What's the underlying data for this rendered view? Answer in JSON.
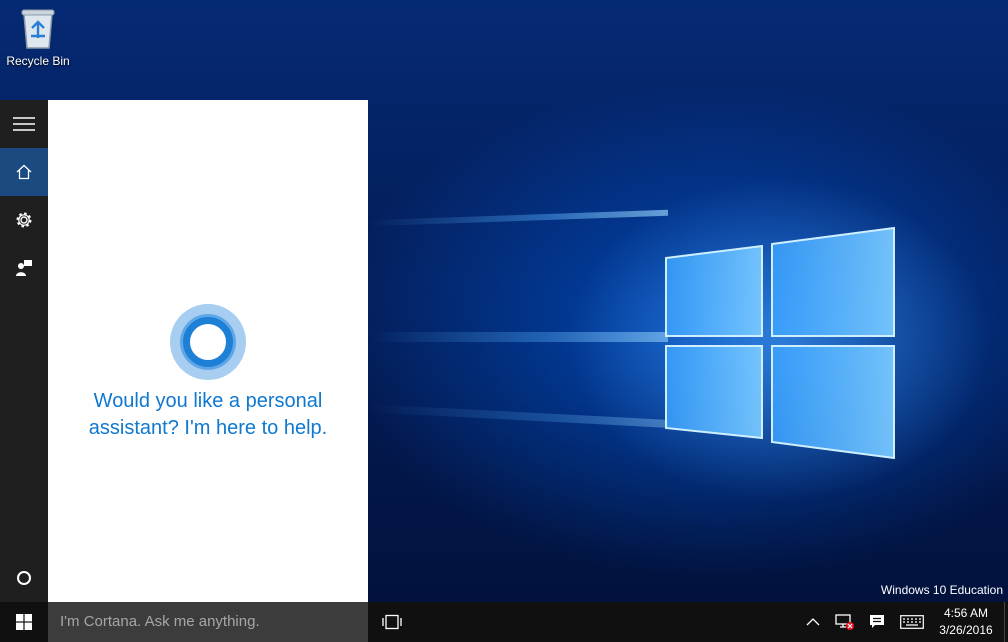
{
  "desktop": {
    "icons": [
      {
        "label": "Recycle Bin",
        "icon": "recycle-bin-icon"
      }
    ],
    "watermark": "Windows 10 Education"
  },
  "cortana": {
    "rail": [
      {
        "name": "menu",
        "icon": "hamburger-icon"
      },
      {
        "name": "home",
        "icon": "home-icon",
        "active": true
      },
      {
        "name": "settings",
        "icon": "gear-icon"
      },
      {
        "name": "feedback",
        "icon": "feedback-icon"
      },
      {
        "name": "cortana",
        "icon": "cortana-circle-icon"
      }
    ],
    "prompt": "Would you like a personal\nassistant? I'm here to help."
  },
  "taskbar": {
    "search_placeholder": "I'm Cortana. Ask me anything.",
    "tray": [
      "chevron-up-icon",
      "network-error-icon",
      "action-center-icon",
      "keyboard-icon"
    ],
    "time": "4:56 AM",
    "date": "3/26/2016"
  },
  "colors": {
    "accent": "#0f78d0",
    "rail_active": "#1a4a80",
    "taskbar": "#101010",
    "search_box": "#3c3c3c"
  }
}
